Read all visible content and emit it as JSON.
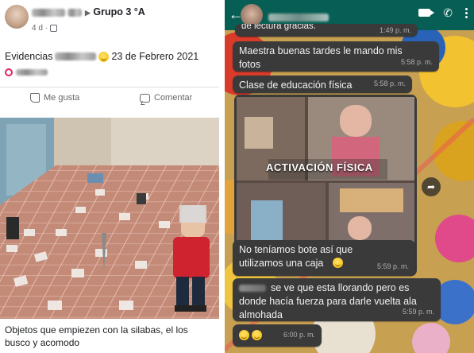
{
  "facebook": {
    "group_name": "Grupo 3 °A",
    "timestamp": "4 d ·",
    "caption_start": "Evidencias",
    "caption_date": "23 de Febrero 2021",
    "like_label": "Me gusta",
    "comment_label": "Comentar",
    "photo_footer": "Objetos que empiezen con la silabas, el los busco y acomodo"
  },
  "whatsapp": {
    "messages": [
      {
        "text": "de lectura gracias.",
        "time": "1:49 p. m."
      },
      {
        "text": "Maestra buenas tardes le mando mis fotos",
        "time": "5:58 p. m."
      },
      {
        "text": "Clase de educación física",
        "time": "5:58 p. m."
      },
      {
        "text": "No teníamos bote así que utilizamos una caja",
        "time": "5:59 p. m."
      },
      {
        "text": "se ve que esta llorando pero es donde hacía fuerza para darle vuelta ala almohada",
        "time": "5:59 p. m."
      },
      {
        "text": "",
        "time": "6:00 p. m."
      }
    ],
    "media_overlay_text": "ACTIVACIÓN FÍSICA"
  },
  "colors": {
    "wa_header": "#075e54",
    "bubble": "#3a3a3a",
    "fb_text": "#1c1e21"
  }
}
